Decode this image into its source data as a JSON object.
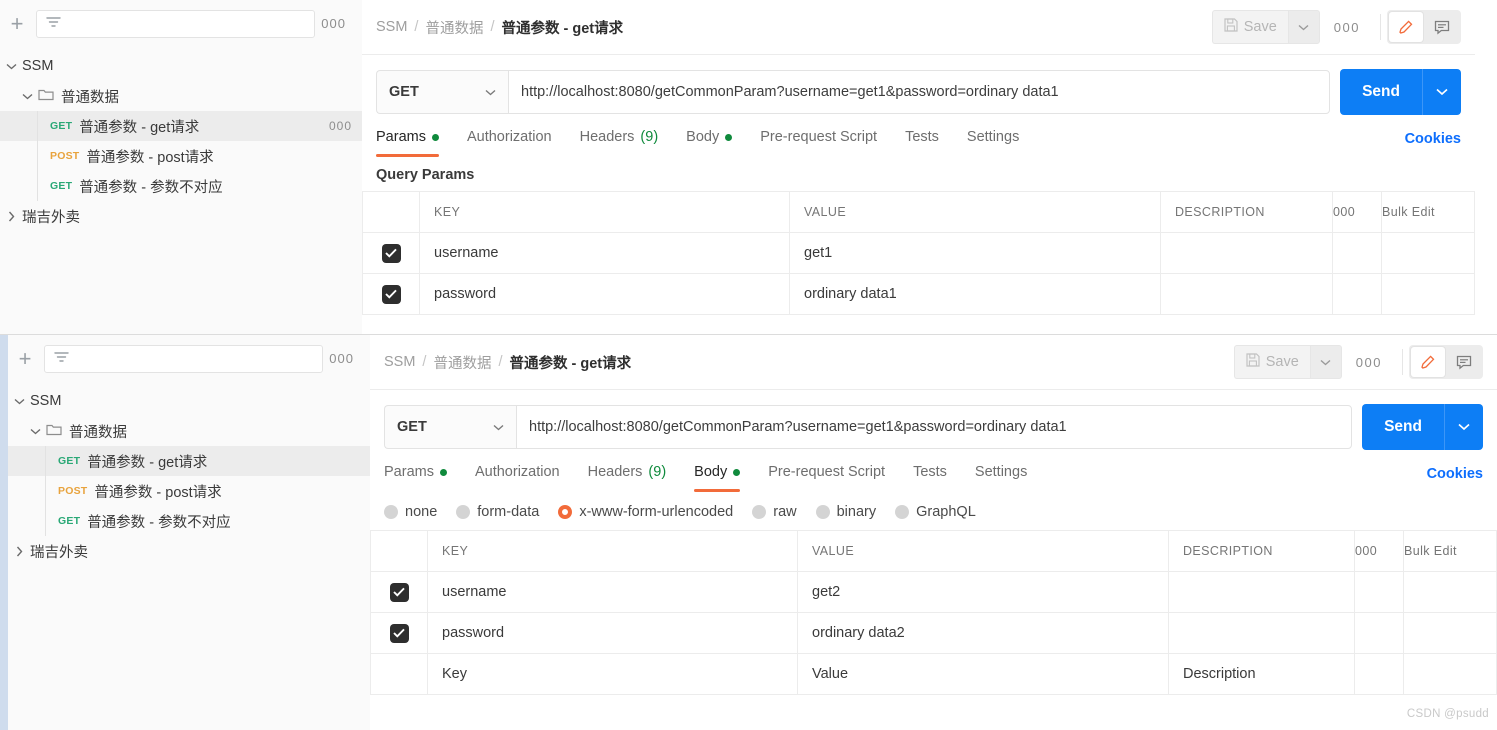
{
  "panels": [
    {
      "id": "top-panel",
      "sidebar": {
        "filter_placeholder": "",
        "add_label": "+",
        "more_label": "000",
        "tree": [
          {
            "label": "SSM",
            "type": "workspace",
            "expanded": true
          },
          {
            "label": "普通数据",
            "type": "folder",
            "expanded": true
          },
          {
            "label": "普通参数 - get请求",
            "type": "request",
            "method": "GET",
            "selected": true
          },
          {
            "label": "普通参数 - post请求",
            "type": "request",
            "method": "POST",
            "selected": false
          },
          {
            "label": "普通参数 - 参数不对应",
            "type": "request",
            "method": "GET",
            "selected": false
          },
          {
            "label": "瑞吉外卖",
            "type": "workspace",
            "expanded": false
          }
        ]
      },
      "header": {
        "breadcrumb": [
          "SSM",
          "普通数据",
          "普通参数 - get请求"
        ],
        "save_label": "Save",
        "more_label": "000"
      },
      "request": {
        "method": "GET",
        "url": "http://localhost:8080/getCommonParam?username=get1&password=ordinary data1",
        "send_label": "Send"
      },
      "tabs": [
        {
          "label": "Params",
          "badge": "dot",
          "active": true
        },
        {
          "label": "Authorization",
          "badge": "",
          "active": false
        },
        {
          "label": "Headers",
          "badge": "(9)",
          "active": false
        },
        {
          "label": "Body",
          "badge": "dot",
          "active": false
        },
        {
          "label": "Pre-request Script",
          "badge": "",
          "active": false
        },
        {
          "label": "Tests",
          "badge": "",
          "active": false
        },
        {
          "label": "Settings",
          "badge": "",
          "active": false
        }
      ],
      "cookies_label": "Cookies",
      "section_title": "Query Params",
      "table": {
        "columns": [
          "KEY",
          "VALUE",
          "DESCRIPTION"
        ],
        "options_label": "000",
        "bulk_edit_label": "Bulk Edit",
        "rows": [
          {
            "checked": true,
            "key": "username",
            "value": "get1",
            "description": ""
          },
          {
            "checked": true,
            "key": "password",
            "value": "ordinary data1",
            "description": ""
          }
        ]
      }
    },
    {
      "id": "bottom-panel",
      "sidebar": {
        "filter_placeholder": "",
        "add_label": "+",
        "more_label": "000",
        "tree": [
          {
            "label": "SSM",
            "type": "workspace",
            "expanded": true
          },
          {
            "label": "普通数据",
            "type": "folder",
            "expanded": true
          },
          {
            "label": "普通参数 - get请求",
            "type": "request",
            "method": "GET",
            "selected": true
          },
          {
            "label": "普通参数 - post请求",
            "type": "request",
            "method": "POST",
            "selected": false
          },
          {
            "label": "普通参数 - 参数不对应",
            "type": "request",
            "method": "GET",
            "selected": false
          },
          {
            "label": "瑞吉外卖",
            "type": "workspace",
            "expanded": false
          }
        ]
      },
      "header": {
        "breadcrumb": [
          "SSM",
          "普通数据",
          "普通参数 - get请求"
        ],
        "save_label": "Save",
        "more_label": "000"
      },
      "request": {
        "method": "GET",
        "url": "http://localhost:8080/getCommonParam?username=get1&password=ordinary data1",
        "send_label": "Send"
      },
      "tabs": [
        {
          "label": "Params",
          "badge": "dot",
          "active": false
        },
        {
          "label": "Authorization",
          "badge": "",
          "active": false
        },
        {
          "label": "Headers",
          "badge": "(9)",
          "active": false
        },
        {
          "label": "Body",
          "badge": "dot",
          "active": true
        },
        {
          "label": "Pre-request Script",
          "badge": "",
          "active": false
        },
        {
          "label": "Tests",
          "badge": "",
          "active": false
        },
        {
          "label": "Settings",
          "badge": "",
          "active": false
        }
      ],
      "cookies_label": "Cookies",
      "body_types": [
        {
          "label": "none",
          "selected": false
        },
        {
          "label": "form-data",
          "selected": false
        },
        {
          "label": "x-www-form-urlencoded",
          "selected": true
        },
        {
          "label": "raw",
          "selected": false
        },
        {
          "label": "binary",
          "selected": false
        },
        {
          "label": "GraphQL",
          "selected": false
        }
      ],
      "table": {
        "columns": [
          "KEY",
          "VALUE",
          "DESCRIPTION"
        ],
        "options_label": "000",
        "bulk_edit_label": "Bulk Edit",
        "rows": [
          {
            "checked": true,
            "key": "username",
            "value": "get2",
            "description": ""
          },
          {
            "checked": true,
            "key": "password",
            "value": "ordinary data2",
            "description": ""
          }
        ],
        "placeholder_row": {
          "key": "Key",
          "value": "Value",
          "description": "Description"
        }
      }
    }
  ],
  "watermark": "CSDN @psudd",
  "colors": {
    "accent_orange": "#f26b3a",
    "send_blue": "#0d7ef5",
    "method_get_green": "#2aa876",
    "method_post_orange": "#e8a33d",
    "dot_green": "#0f8a3c",
    "link_blue": "#0d6efd"
  }
}
